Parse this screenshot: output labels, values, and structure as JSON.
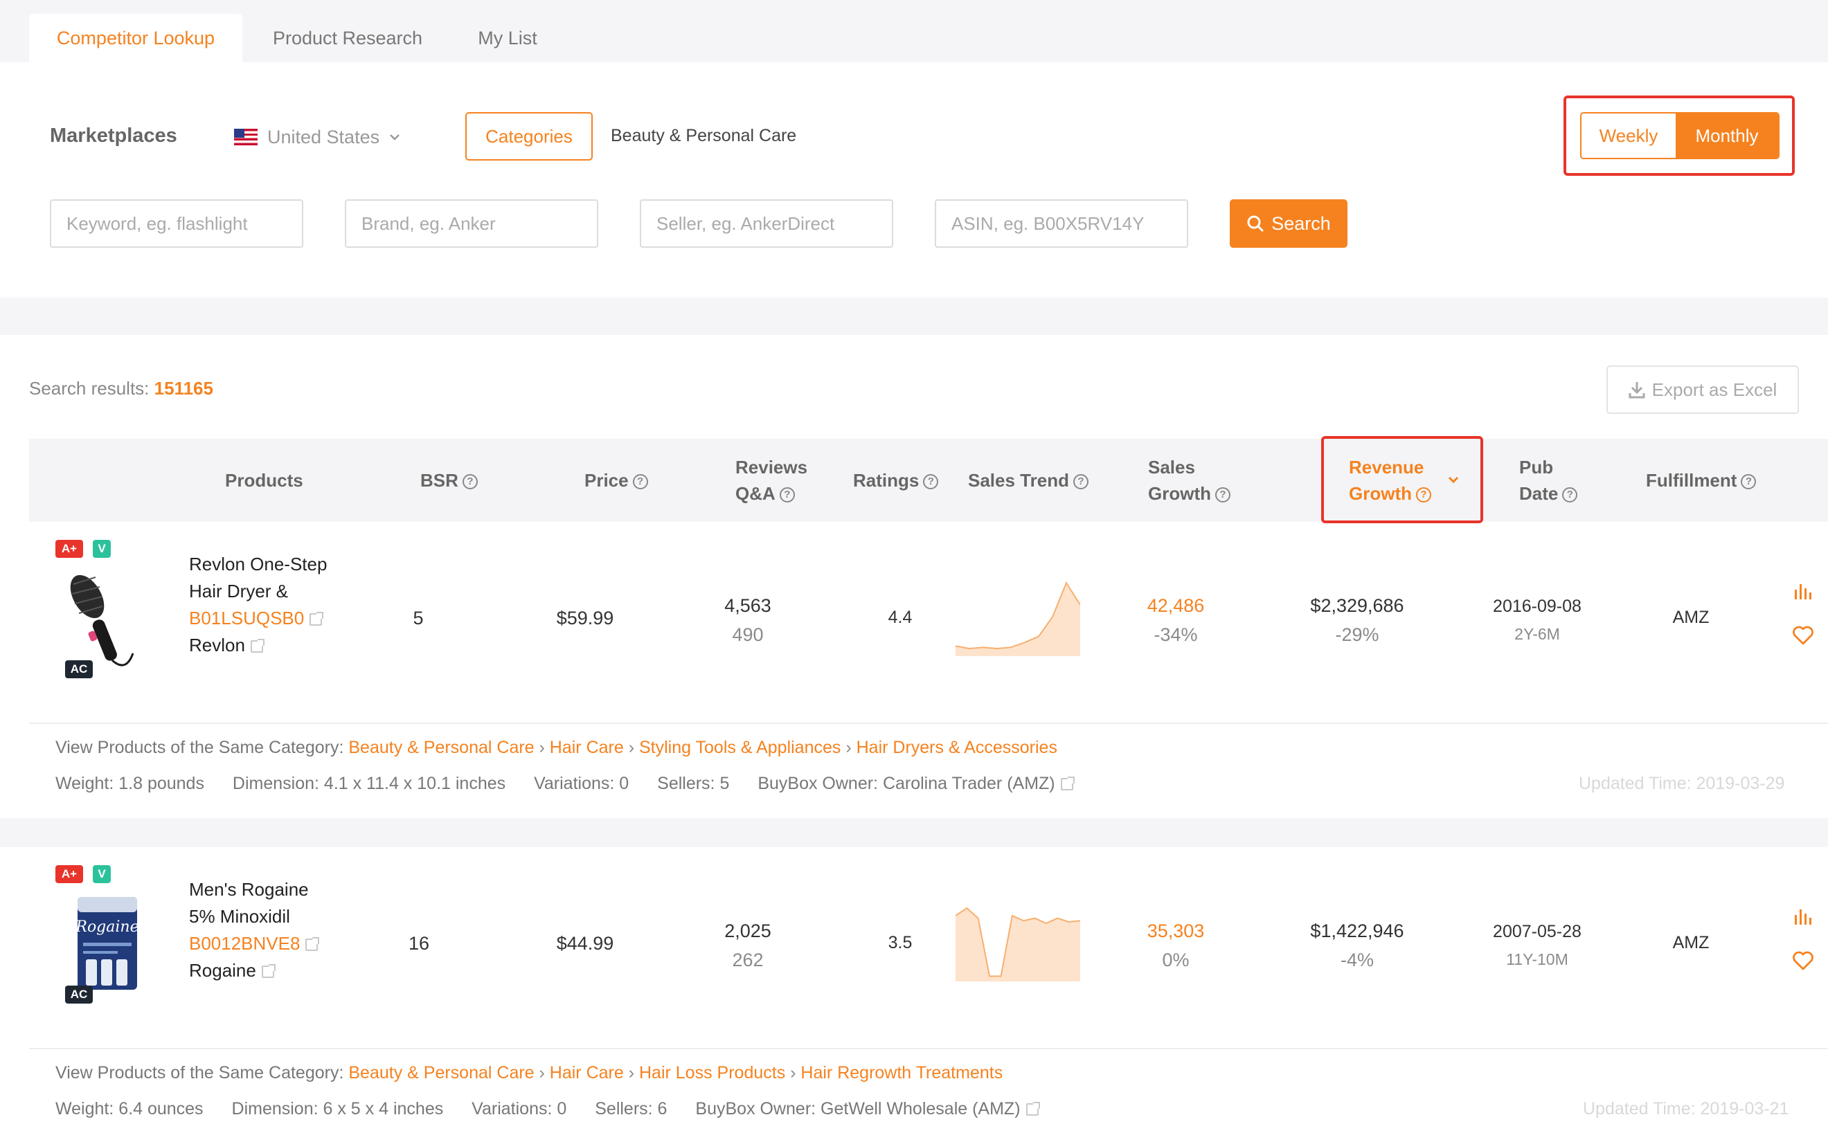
{
  "tabs": [
    {
      "label": "Competitor Lookup",
      "active": true
    },
    {
      "label": "Product Research",
      "active": false
    },
    {
      "label": "My List",
      "active": false
    }
  ],
  "filters": {
    "marketplaces_label": "Marketplaces",
    "marketplace_value": "United States",
    "categories_button": "Categories",
    "category_value": "Beauty & Personal Care",
    "period_weekly": "Weekly",
    "period_monthly": "Monthly",
    "active_period": "Monthly",
    "keyword_placeholder": "Keyword, eg. flashlight",
    "brand_placeholder": "Brand, eg. Anker",
    "seller_placeholder": "Seller, eg. AnkerDirect",
    "asin_placeholder": "ASIN, eg. B00X5RV14Y",
    "search_button": "Search"
  },
  "results": {
    "label": "Search results:",
    "count": "151165",
    "export_button": "Export as Excel"
  },
  "columns": {
    "products": "Products",
    "bsr": "BSR",
    "price": "Price",
    "reviews_1": "Reviews",
    "reviews_2": "Q&A",
    "ratings": "Ratings",
    "sales_trend": "Sales Trend",
    "sales_growth_1": "Sales",
    "sales_growth_2": "Growth",
    "revenue_growth_1": "Revenue",
    "revenue_growth_2": "Growth",
    "pub_date_1": "Pub",
    "pub_date_2": "Date",
    "fulfillment": "Fulfillment"
  },
  "products": [
    {
      "badges": {
        "aplus": "A+",
        "v": "V",
        "ac": "AC"
      },
      "title_line1": "Revlon One-Step",
      "title_line2": "Hair Dryer &",
      "asin": "B01LSUQSB0",
      "brand": "Revlon",
      "bsr": "5",
      "price": "$59.99",
      "reviews": "4,563",
      "qa": "490",
      "rating": "4.4",
      "sales_trend": [
        6,
        4,
        5,
        4,
        5,
        9,
        14,
        30,
        58,
        40
      ],
      "sales": "42,486",
      "sales_growth": "-34%",
      "revenue": "$2,329,686",
      "revenue_growth": "-29%",
      "pub_date": "2016-09-08",
      "age": "2Y-6M",
      "fulfillment": "AMZ",
      "category_prefix": "View Products of the Same Category:",
      "category_path": [
        "Beauty & Personal Care",
        "Hair Care",
        "Styling Tools & Appliances",
        "Hair Dryers & Accessories"
      ],
      "weight": "Weight: 1.8 pounds",
      "dimension": "Dimension: 4.1 x 11.4 x 10.1 inches",
      "variations": "Variations: 0",
      "sellers": "Sellers: 5",
      "buybox": "BuyBox Owner: Carolina Trader (AMZ)",
      "updated": "Updated Time: 2019-03-29"
    },
    {
      "badges": {
        "aplus": "A+",
        "v": "V",
        "ac": "AC"
      },
      "title_line1": "Men's Rogaine",
      "title_line2": "5% Minoxidil",
      "asin": "B0012BNVE8",
      "brand": "Rogaine",
      "bsr": "16",
      "price": "$44.99",
      "reviews": "2,025",
      "qa": "262",
      "rating": "3.5",
      "sales_trend": [
        50,
        56,
        48,
        2,
        2,
        50,
        46,
        48,
        44,
        48,
        45,
        46
      ],
      "sales": "35,303",
      "sales_growth": "0%",
      "revenue": "$1,422,946",
      "revenue_growth": "-4%",
      "pub_date": "2007-05-28",
      "age": "11Y-10M",
      "fulfillment": "AMZ",
      "category_prefix": "View Products of the Same Category:",
      "category_path": [
        "Beauty & Personal Care",
        "Hair Care",
        "Hair Loss Products",
        "Hair Regrowth Treatments"
      ],
      "weight": "Weight: 6.4 ounces",
      "dimension": "Dimension: 6 x 5 x 4 inches",
      "variations": "Variations: 0",
      "sellers": "Sellers: 6",
      "buybox": "BuyBox Owner: GetWell Wholesale (AMZ)",
      "updated": "Updated Time: 2019-03-21"
    }
  ],
  "colors": {
    "accent": "#f5821f",
    "highlight": "#e8342a",
    "badge_aplus": "#e8342a",
    "badge_v": "#2bc29b",
    "badge_ac": "#1f2733"
  }
}
